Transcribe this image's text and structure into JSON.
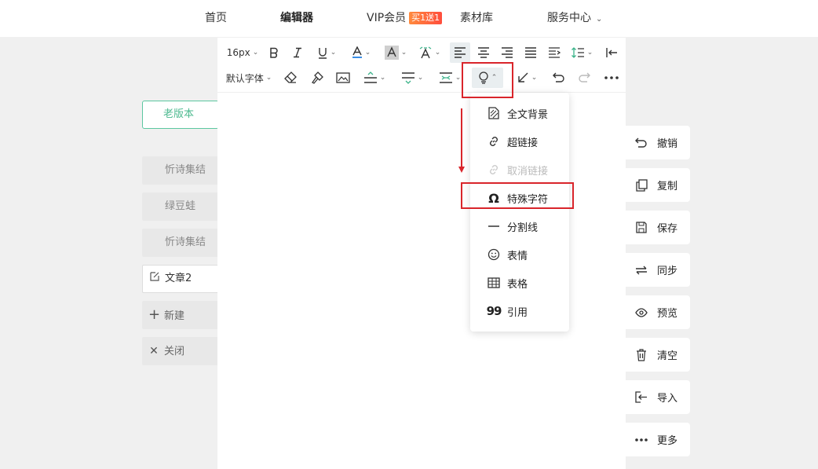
{
  "nav": {
    "home": "首页",
    "editor": "编辑器",
    "vip": "VIP会员",
    "vip_badge": "买1送1",
    "materials": "素材库",
    "service": "服务中心"
  },
  "left": {
    "old_version": "老版本",
    "docs": [
      "忻诗集结",
      "绿豆蛙",
      "忻诗集结"
    ],
    "current_doc": "文章2",
    "new": "新建",
    "close": "关闭"
  },
  "toolbar": {
    "font_size": "16px",
    "font_family": "默认字体"
  },
  "dropdown": {
    "items": [
      {
        "label": "全文背景",
        "icon": "page-background-icon",
        "disabled": false
      },
      {
        "label": "超链接",
        "icon": "link-icon",
        "disabled": false
      },
      {
        "label": "取消链接",
        "icon": "unlink-icon",
        "disabled": true
      },
      {
        "label": "特殊字符",
        "icon": "omega-icon",
        "disabled": false
      },
      {
        "label": "分割线",
        "icon": "divider-icon",
        "disabled": false
      },
      {
        "label": "表情",
        "icon": "smiley-icon",
        "disabled": false
      },
      {
        "label": "表格",
        "icon": "table-icon",
        "disabled": false
      },
      {
        "label": "引用",
        "icon": "quote-icon",
        "disabled": false
      }
    ]
  },
  "right": {
    "undo": "撤销",
    "copy": "复制",
    "save": "保存",
    "sync": "同步",
    "preview": "预览",
    "clear": "清空",
    "import": "导入",
    "more": "更多"
  },
  "colors": {
    "accent_green": "#4cb98f",
    "annotation_red": "#d9252b",
    "vip_orange": "#ff5a3d"
  }
}
